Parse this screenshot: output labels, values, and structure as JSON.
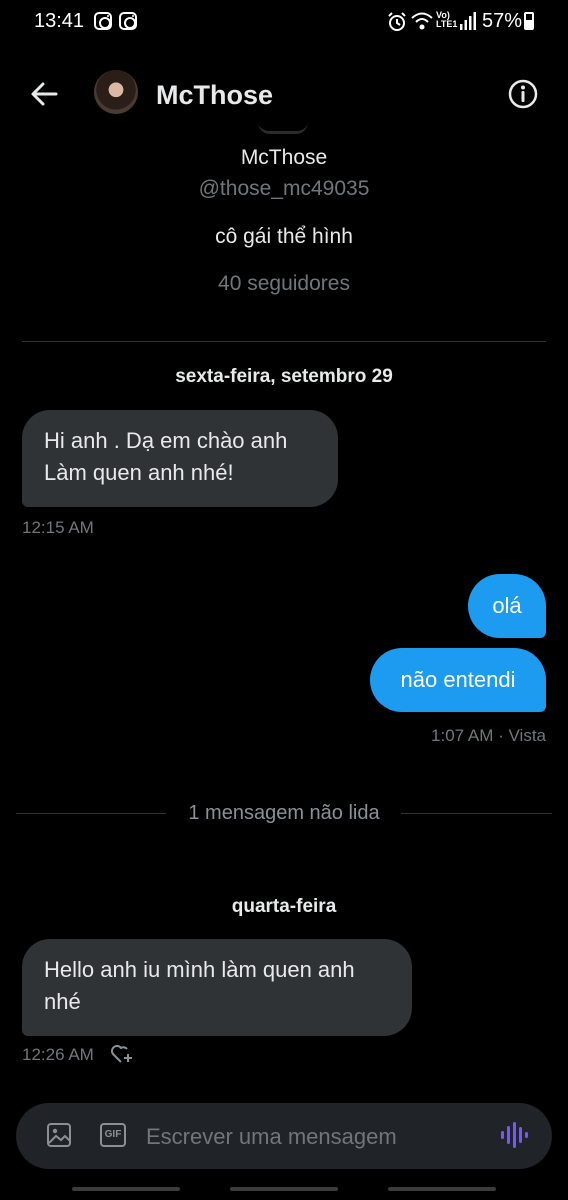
{
  "status_bar": {
    "time": "13:41",
    "battery": "57%",
    "icons": [
      "instagram-icon",
      "instagram-icon",
      "alarm-icon",
      "wifi-icon",
      "volte-icon",
      "signal-icon",
      "battery-icon"
    ]
  },
  "header": {
    "name": "McThose",
    "back_icon": "arrow-left-icon",
    "info_icon": "info-icon"
  },
  "profile": {
    "name": "McThose",
    "handle": "@those_mc49035",
    "bio": "cô gái thể hình",
    "followers": "40 seguidores"
  },
  "conversation": {
    "date1": "sexta-feira, setembro 29",
    "msg1": {
      "line1": "Hi anh . Dạ em chào anh",
      "line2": "Làm quen anh nhé!",
      "time": "12:15 AM"
    },
    "msg2": {
      "text": "olá"
    },
    "msg3": {
      "text": "não entendi",
      "meta": "1:07 AM · Vista"
    },
    "unread": "1 mensagem não lida",
    "date2": "quarta-feira",
    "msg4": {
      "line1": "Hello anh iu mình làm quen anh",
      "line2": "nhé",
      "time": "12:26 AM"
    }
  },
  "composer": {
    "placeholder": "Escrever uma mensagem",
    "gif_label": "GIF"
  },
  "colors": {
    "background": "#000000",
    "incoming_bubble": "#2f3336",
    "outgoing_bubble": "#1d9bf0",
    "muted_text": "#71767b",
    "voice_accent": "#7856ff"
  }
}
